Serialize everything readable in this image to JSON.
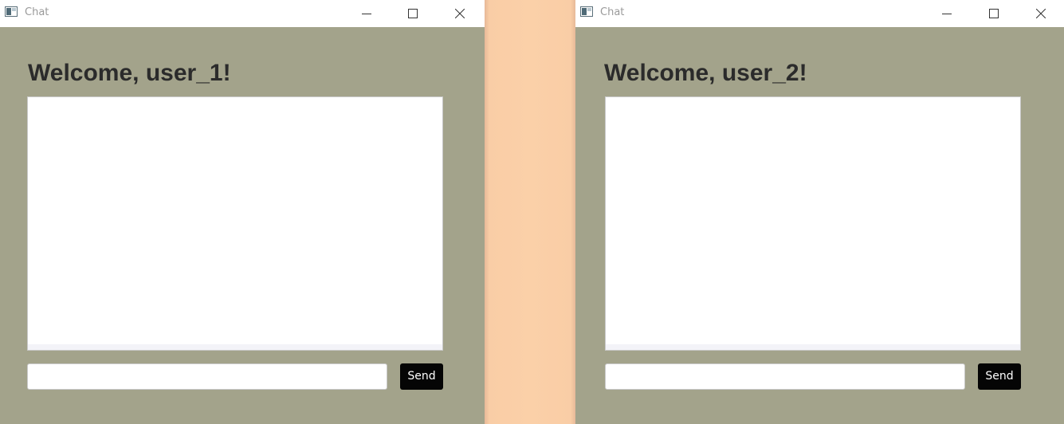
{
  "windows": [
    {
      "title": "Chat",
      "welcome": "Welcome, user_1!",
      "message_input_value": "",
      "send_label": "Send"
    },
    {
      "title": "Chat",
      "welcome": "Welcome, user_2!",
      "message_input_value": "",
      "send_label": "Send"
    }
  ],
  "icons": {
    "app": "app-window-icon",
    "minimize": "minimize-icon",
    "maximize": "maximize-icon",
    "close": "close-icon"
  },
  "colors": {
    "window_background": "#a3a38b",
    "desktop_background": "#fbd0a7",
    "titlebar": "#ffffff",
    "send_button": "#050505",
    "heading_text": "#2b2b2b"
  }
}
